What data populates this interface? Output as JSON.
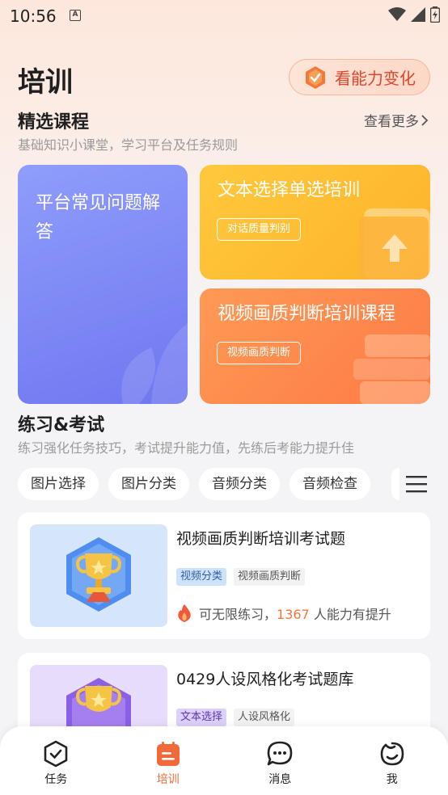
{
  "status_bar": {
    "time": "10:56",
    "notif_letter": "A"
  },
  "header": {
    "title": "培训",
    "ability_button": "看能力变化"
  },
  "featured": {
    "title": "精选课程",
    "subtitle": "基础知识小课堂，学习平台及任务规则",
    "more": "查看更多",
    "cards": [
      {
        "title_line1": "平台常见问题解",
        "title_line2": "答"
      },
      {
        "title": "文本选择单选培训",
        "tag": "对话质量判别"
      },
      {
        "title": "视频画质判断培训课程",
        "tag": "视频画质判断"
      }
    ]
  },
  "practice": {
    "title": "练习&考试",
    "subtitle": "练习强化任务技巧，考试提升能力值，先练后考能力提升佳",
    "chips": [
      "图片选择",
      "图片分类",
      "音频分类",
      "音频检查"
    ]
  },
  "exams": [
    {
      "title": "视频画质判断培训考试题",
      "tag_type": "视频分类",
      "tag_name": "视频画质判断",
      "practice_text": "可无限练习，",
      "count": "1367",
      "count_suffix": " 人能力有提升"
    },
    {
      "title": "0429人设风格化考试题库",
      "tag_type": "文本选择",
      "tag_name": "人设风格化"
    }
  ],
  "tabbar": [
    {
      "label": "任务",
      "icon": "task-check-icon"
    },
    {
      "label": "培训",
      "icon": "training-icon"
    },
    {
      "label": "消息",
      "icon": "message-icon"
    },
    {
      "label": "我",
      "icon": "profile-icon"
    }
  ],
  "colors": {
    "accent": "#f36a3a",
    "blue_card": "#7b84f4",
    "yellow_card": "#fdbb33",
    "orange_card": "#fd8a4d"
  }
}
